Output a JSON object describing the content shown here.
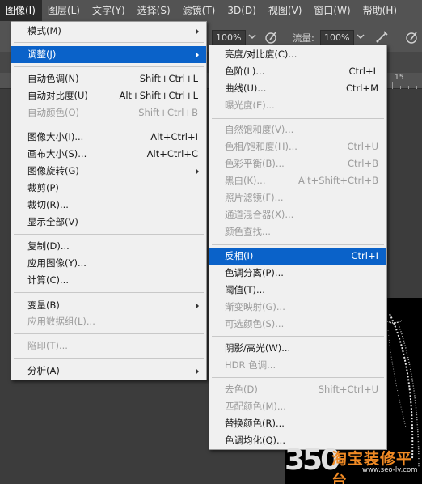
{
  "menubar": {
    "items": [
      {
        "label": "图像(I)",
        "left": 0
      },
      {
        "label": "图层(L)"
      },
      {
        "label": "文字(Y)"
      },
      {
        "label": "选择(S)"
      },
      {
        "label": "滤镜(T)"
      },
      {
        "label": "3D(D)"
      },
      {
        "label": "视图(V)"
      },
      {
        "label": "窗口(W)"
      },
      {
        "label": "帮助(H)"
      }
    ]
  },
  "options": {
    "opacity_value": "100%",
    "flow_label": "流量:",
    "flow_value": "100%"
  },
  "ruler": {
    "labels": [
      "15"
    ]
  },
  "image_menu": {
    "items": [
      {
        "label": "模式(M)",
        "shortcut": "",
        "submenu": true
      },
      {
        "label": "调整(J)",
        "shortcut": "",
        "submenu": true
      },
      {
        "label": "自动色调(N)",
        "shortcut": "Shift+Ctrl+L"
      },
      {
        "label": "自动对比度(U)",
        "shortcut": "Alt+Shift+Ctrl+L"
      },
      {
        "label": "自动颜色(O)",
        "shortcut": "Shift+Ctrl+B"
      },
      {
        "label": "图像大小(I)...",
        "shortcut": "Alt+Ctrl+I"
      },
      {
        "label": "画布大小(S)...",
        "shortcut": "Alt+Ctrl+C"
      },
      {
        "label": "图像旋转(G)",
        "shortcut": "",
        "submenu": true
      },
      {
        "label": "裁剪(P)",
        "shortcut": ""
      },
      {
        "label": "裁切(R)...",
        "shortcut": ""
      },
      {
        "label": "显示全部(V)",
        "shortcut": ""
      },
      {
        "label": "复制(D)...",
        "shortcut": ""
      },
      {
        "label": "应用图像(Y)...",
        "shortcut": ""
      },
      {
        "label": "计算(C)...",
        "shortcut": ""
      },
      {
        "label": "变量(B)",
        "shortcut": "",
        "submenu": true
      },
      {
        "label": "应用数据组(L)...",
        "shortcut": ""
      },
      {
        "label": "陷印(T)...",
        "shortcut": ""
      },
      {
        "label": "分析(A)",
        "shortcut": "",
        "submenu": true
      }
    ]
  },
  "adjust_menu": {
    "items": [
      {
        "label": "亮度/对比度(C)...",
        "shortcut": ""
      },
      {
        "label": "色阶(L)...",
        "shortcut": "Ctrl+L"
      },
      {
        "label": "曲线(U)...",
        "shortcut": "Ctrl+M"
      },
      {
        "label": "曝光度(E)...",
        "shortcut": ""
      },
      {
        "label": "自然饱和度(V)...",
        "shortcut": ""
      },
      {
        "label": "色相/饱和度(H)...",
        "shortcut": "Ctrl+U"
      },
      {
        "label": "色彩平衡(B)...",
        "shortcut": "Ctrl+B"
      },
      {
        "label": "黑白(K)...",
        "shortcut": "Alt+Shift+Ctrl+B"
      },
      {
        "label": "照片滤镜(F)...",
        "shortcut": ""
      },
      {
        "label": "通道混合器(X)...",
        "shortcut": ""
      },
      {
        "label": "颜色查找...",
        "shortcut": ""
      },
      {
        "label": "反相(I)",
        "shortcut": "Ctrl+I"
      },
      {
        "label": "色调分离(P)...",
        "shortcut": ""
      },
      {
        "label": "阈值(T)...",
        "shortcut": ""
      },
      {
        "label": "渐变映射(G)...",
        "shortcut": ""
      },
      {
        "label": "可选颜色(S)...",
        "shortcut": ""
      },
      {
        "label": "阴影/高光(W)...",
        "shortcut": ""
      },
      {
        "label": "HDR 色调...",
        "shortcut": ""
      },
      {
        "label": "去色(D)",
        "shortcut": "Shift+Ctrl+U"
      },
      {
        "label": "匹配颜色(M)...",
        "shortcut": ""
      },
      {
        "label": "替换颜色(R)...",
        "shortcut": ""
      },
      {
        "label": "色调均化(Q)...",
        "shortcut": ""
      }
    ]
  },
  "watermark": {
    "number": "350",
    "name": "淘宝装修平台",
    "url": "www.seo-lv.com"
  },
  "colors": {
    "highlight": "#0a62c9",
    "menu_bg": "#f0f0f0",
    "disabled_text": "#9b9b9b",
    "app_bg": "#535353"
  }
}
